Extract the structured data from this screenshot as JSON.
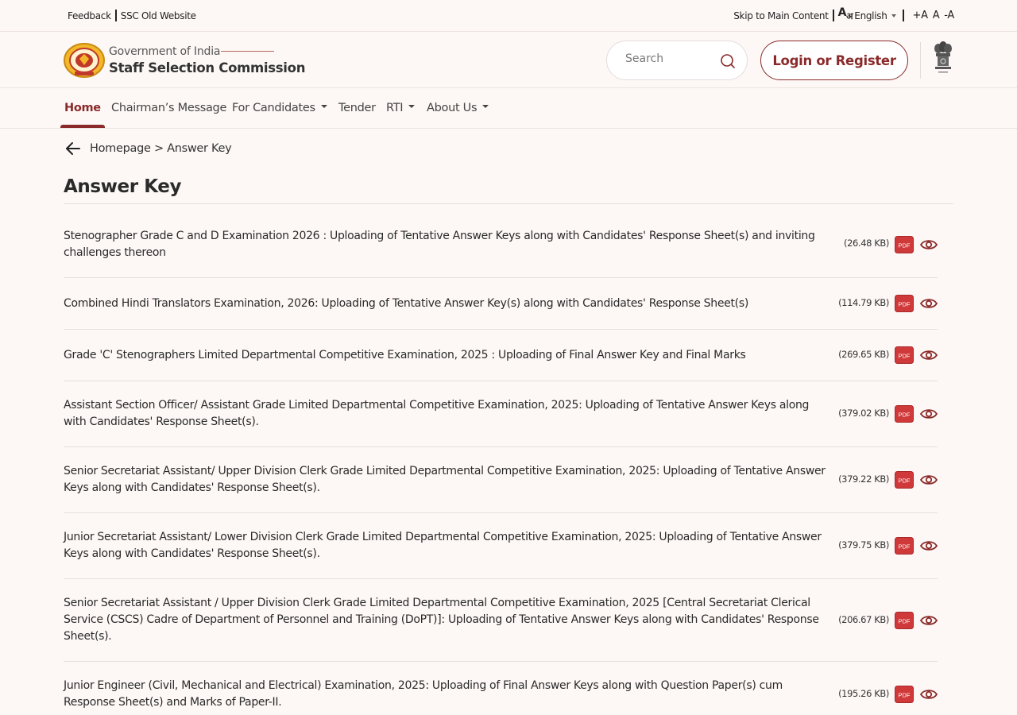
{
  "topbar": {
    "feedback": "Feedback",
    "old_website": "SSC Old Website",
    "skip": "Skip to Main Content",
    "language": "English",
    "font_increase": "+A",
    "font_normal": "A",
    "font_decrease": "-A"
  },
  "header": {
    "org_line1": "Government of India",
    "org_line2": "Staff Selection Commission",
    "search_placeholder": "Search",
    "login_label": "Login or Register"
  },
  "nav": {
    "items": [
      {
        "label": "Home",
        "active": true
      },
      {
        "label": "Chairman’s Message"
      },
      {
        "label": "For Candidates",
        "dropdown": true
      },
      {
        "label": "Tender"
      },
      {
        "label": "RTI",
        "dropdown": true
      },
      {
        "label": "About Us",
        "dropdown": true
      }
    ]
  },
  "breadcrumb": {
    "text": "Homepage > Answer Key"
  },
  "page": {
    "title": "Answer Key"
  },
  "colors": {
    "brand": "#8a2a2a",
    "pdf_red": "#d0393a",
    "background": "#fdf8f6"
  },
  "answer_keys": [
    {
      "title": "Stenographer Grade C and D Examination 2026 : Uploading of Tentative Answer Keys along with Candidates' Response Sheet(s) and inviting challenges thereon",
      "size": "(26.48 KB)",
      "pdf_label": "PDF"
    },
    {
      "title": "Combined Hindi Translators Examination, 2026: Uploading of Tentative Answer Key(s) along with Candidates' Response Sheet(s)",
      "size": "(114.79 KB)",
      "pdf_label": "PDF"
    },
    {
      "title": "Grade 'C' Stenographers Limited Departmental Competitive Examination, 2025 : Uploading of Final Answer Key and Final Marks",
      "size": "(269.65 KB)",
      "pdf_label": "PDF"
    },
    {
      "title": "Assistant Section Officer/ Assistant Grade Limited Departmental Competitive Examination, 2025: Uploading of Tentative Answer Keys along with Candidates' Response Sheet(s).",
      "size": "(379.02 KB)",
      "pdf_label": "PDF"
    },
    {
      "title": "Senior Secretariat Assistant/ Upper Division Clerk Grade Limited Departmental Competitive Examination, 2025: Uploading of Tentative Answer Keys along with Candidates' Response Sheet(s).",
      "size": "(379.22 KB)",
      "pdf_label": "PDF"
    },
    {
      "title": "Junior Secretariat Assistant/ Lower Division Clerk Grade Limited Departmental Competitive Examination, 2025: Uploading of Tentative Answer Keys along with Candidates' Response Sheet(s).",
      "size": "(379.75 KB)",
      "pdf_label": "PDF"
    },
    {
      "title": "Senior Secretariat Assistant / Upper Division Clerk Grade Limited Departmental Competitive Examination, 2025 [Central Secretariat Clerical Service (CSCS) Cadre of Department of Personnel and Training (DoPT)]: Uploading of Tentative Answer Keys along with Candidates' Response Sheet(s).",
      "size": "(206.67 KB)",
      "pdf_label": "PDF"
    },
    {
      "title": "Junior Engineer (Civil, Mechanical and Electrical) Examination, 2025: Uploading of Final Answer Keys along with Question Paper(s) cum Response Sheet(s) and Marks of Paper-II.",
      "size": "(195.26 KB)",
      "pdf_label": "PDF"
    }
  ]
}
